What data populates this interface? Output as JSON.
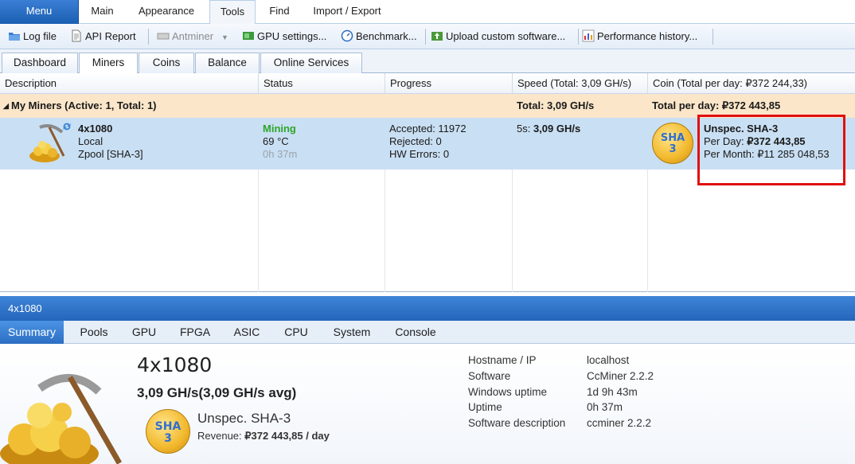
{
  "ribbon": {
    "menu": "Menu",
    "main": "Main",
    "appearance": "Appearance",
    "tools": "Tools",
    "find": "Find",
    "import_export": "Import / Export"
  },
  "toolbar": {
    "log_file": "Log file",
    "api_report": "API Report",
    "antminer": "Antminer",
    "gpu_settings": "GPU settings...",
    "benchmark": "Benchmark...",
    "upload": "Upload custom software...",
    "performance": "Performance history..."
  },
  "nav_tabs": [
    "Dashboard",
    "Miners",
    "Coins",
    "Balance",
    "Online Services"
  ],
  "grid": {
    "headers": {
      "description": "Description",
      "status": "Status",
      "progress": "Progress",
      "speed": "Speed (Total: 3,09 GH/s)",
      "coin": "Coin (Total per day: ₽372 244,33)"
    },
    "group": {
      "label": "My Miners (Active: 1, Total: 1)",
      "total_speed": "Total: 3,09 GH/s",
      "total_per_day": "Total per day: ₽372 443,85"
    },
    "miner": {
      "name": "4x1080",
      "location": "Local",
      "pool": "Zpool [SHA-3]",
      "status": "Mining",
      "temp": "69 °C",
      "uptime": "0h 37m",
      "accepted": "Accepted: 11972",
      "rejected": "Rejected: 0",
      "hw_errors": "HW Errors: 0",
      "speed_prefix": "5s:",
      "speed_value": "3,09 GH/s",
      "coin_name": "Unspec. SHA-3",
      "per_day_label": "Per Day:",
      "per_day_value": "₽372 443,85",
      "per_month": "Per Month: ₽11 285 048,53",
      "badge_top": "SHA",
      "badge_bottom": "3"
    }
  },
  "detail": {
    "header": "4x1080",
    "tabs": [
      "Summary",
      "Pools",
      "GPU",
      "FPGA",
      "ASIC",
      "CPU",
      "System",
      "Console"
    ],
    "name": "4x1080",
    "speed": "3,09 GH/s(3,09 GH/s avg)",
    "coin": "Unspec. SHA-3",
    "revenue_label": "Revenue:",
    "revenue_value": "₽372 443,85 / day",
    "badge_top": "SHA",
    "badge_bottom": "3",
    "info": [
      {
        "label": "Hostname / IP",
        "value": "localhost"
      },
      {
        "label": "Software",
        "value": "CcMiner 2.2.2"
      },
      {
        "label": "Windows uptime",
        "value": "1d 9h 43m"
      },
      {
        "label": "Uptime",
        "value": "0h 37m"
      },
      {
        "label": "Software description",
        "value": "ccminer 2.2.2"
      }
    ]
  },
  "colors": {
    "accent": "#2466bb",
    "mining_status": "#2ca52c",
    "group_row": "#fbe6c9",
    "selected_row": "#c9dff3",
    "highlight": "#e01010"
  }
}
